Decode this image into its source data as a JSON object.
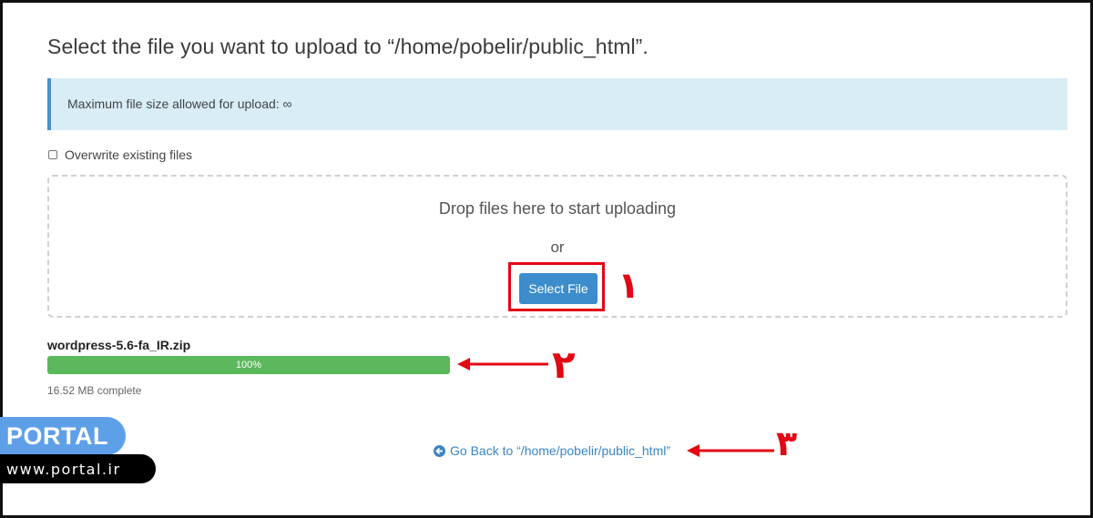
{
  "header": {
    "title": "Select the file you want to upload to “/home/pobelir/public_html”."
  },
  "info": {
    "text": "Maximum file size allowed for upload: ∞"
  },
  "options": {
    "overwrite_label": "Overwrite existing files",
    "overwrite_checked": false
  },
  "dropzone": {
    "text": "Drop files here to start uploading",
    "or_text": "or",
    "select_button": "Select File"
  },
  "upload": {
    "file_name": "wordpress-5.6-fa_IR.zip",
    "progress_percent": 100,
    "progress_label": "100%",
    "status": "16.52 MB complete"
  },
  "footer": {
    "go_back": "Go Back to “/home/pobelir/public_html”"
  },
  "annotations": {
    "step1": "۱",
    "step2": "۲",
    "step3": "۳",
    "color": "#e30613"
  },
  "watermark": {
    "brand": "PORTAL",
    "url": "www.portal.ir"
  },
  "colors": {
    "accent": "#3d8ccb",
    "progress": "#5cb85c",
    "info_bg": "#d9edf7"
  },
  "icons": {
    "go_back": "circle-arrow-left-icon",
    "arrows": "left-arrow-icon"
  }
}
